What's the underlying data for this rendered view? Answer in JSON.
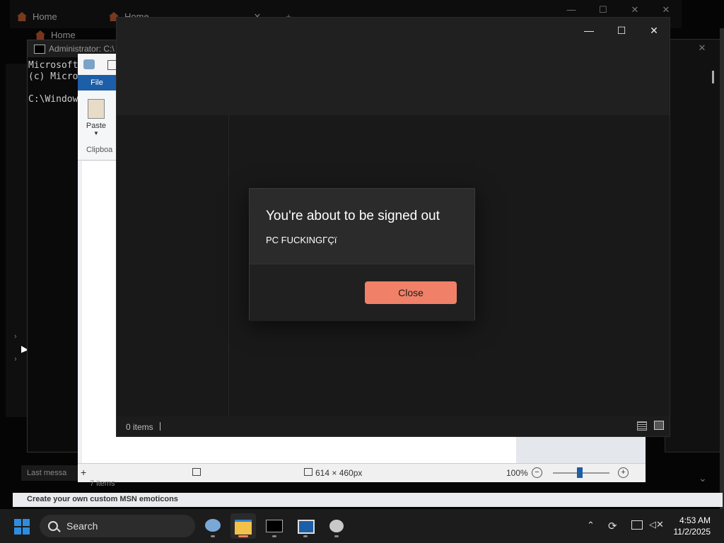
{
  "background_tabs": [
    {
      "label": "Home"
    },
    {
      "label": "Home"
    },
    {
      "label": "Home"
    }
  ],
  "cmd": {
    "title": "Administrator: C:\\",
    "lines": [
      "Microsoft",
      "(c) Micro",
      "",
      "C:\\Window"
    ]
  },
  "paint": {
    "file_tab": "File",
    "paste_label": "Paste",
    "clipboard_label": "Clipboa",
    "status_size": "614 × 460px",
    "zoom": "100%"
  },
  "bg_status": {
    "items": "7 items",
    "last_message": "Last messa",
    "strip_text": "Create your own custom MSN emoticons"
  },
  "explorer": {
    "items_count": "0 items"
  },
  "dialog": {
    "title": "You're about to be signed out",
    "message": "PC FUCKINGΓÇï",
    "close_label": "Close"
  },
  "taskbar": {
    "search_placeholder": "Search",
    "time": "4:53 AM",
    "date": "11/2/2025"
  },
  "colors": {
    "dialog_button": "#f08068",
    "paint_file_tab": "#1c5ea8",
    "taskbar": "#1c1c1c"
  }
}
